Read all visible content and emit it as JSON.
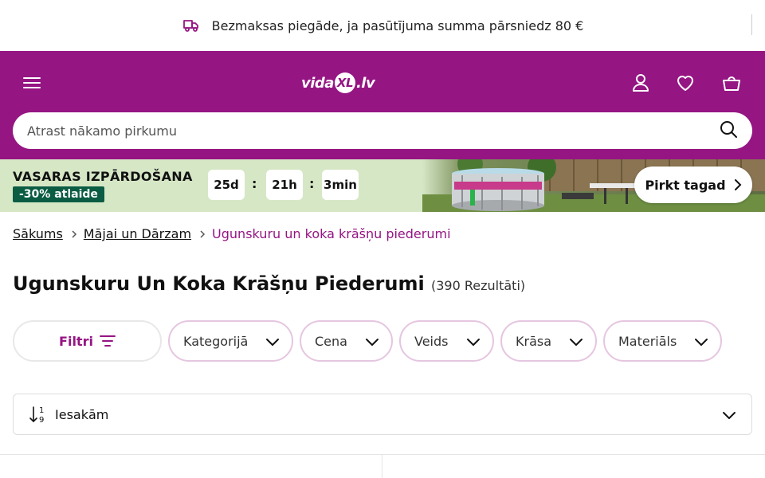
{
  "topbar": {
    "shipping_text": "Bezmaksas piegāde, ja pasūtījuma summa pārsniedz 80 €"
  },
  "header": {
    "logo_text_pre": "vida",
    "logo_text_xl": "XL",
    "logo_text_post": ".lv",
    "search_placeholder": "Atrast nākamo pirkumu"
  },
  "promo": {
    "title": "VASARAS IZPĀRDOŠANA",
    "badge": "-30% atlaide",
    "countdown": {
      "days": "25d",
      "hours": "21h",
      "minutes": "3min"
    },
    "cta": "Pirkt tagad"
  },
  "breadcrumb": {
    "items": [
      "Sākums",
      "Mājai un Dārzam"
    ],
    "current": "Ugunskuru un koka krāšņu piederumi"
  },
  "page": {
    "title": "Ugunskuru Un Koka Krāšņu Piederumi",
    "count": "(390 Rezultāti)"
  },
  "filters": {
    "filter_label": "Filtri",
    "chips": [
      "Kategorijā",
      "Cena",
      "Veids",
      "Krāsa",
      "Materiāls"
    ]
  },
  "sort": {
    "label": "Iesakām"
  },
  "colors": {
    "brand": "#951583",
    "promo_bg": "#d6e7c6",
    "badge": "#0a5c43",
    "chip_border": "#e5c6e0"
  }
}
